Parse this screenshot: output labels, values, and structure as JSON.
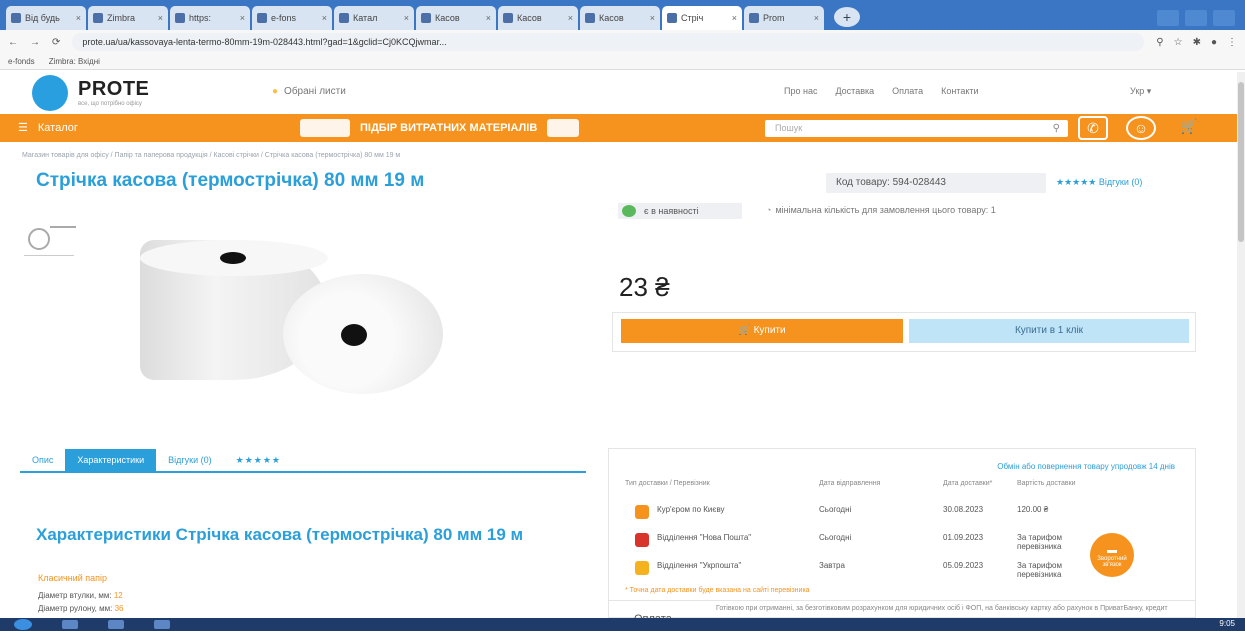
{
  "browser": {
    "tabs": [
      {
        "label": "Від будь"
      },
      {
        "label": "Zimbra"
      },
      {
        "label": "https:"
      },
      {
        "label": "e-fons"
      },
      {
        "label": "Катал"
      },
      {
        "label": "Касов"
      },
      {
        "label": "Касов"
      },
      {
        "label": "Касов"
      },
      {
        "label": "Стріч",
        "active": true
      },
      {
        "label": "Prom"
      }
    ],
    "new_tab": "+",
    "url": "prote.ua/ua/kassovaya-lenta-termo-80mm-19m-028443.html?gad=1&gclid=Cj0KCQjwmar...",
    "bookmarks": [
      "e-fonds",
      "Zimbra: Вхідні"
    ]
  },
  "header": {
    "logo": "PROTE",
    "logo_tagline": "все, що потрібно офісу",
    "favorites": "Обрані листи",
    "nav": [
      "Про нас",
      "Доставка",
      "Оплата",
      "Контакти"
    ],
    "lang": "Укр"
  },
  "orange_bar": {
    "catalog": "Каталог",
    "consumables": "ПІДБІР ВИТРАТНИХ МАТЕРІАЛІВ",
    "search_placeholder": "Пошук",
    "cart_count": "0"
  },
  "breadcrumb": "Магазин товарів для офісу / Папір та паперова продукція / Касові стрічки / Стрічка касова (термострічка) 80 мм 19 м",
  "product": {
    "title": "Стрічка касова (термострічка) 80 мм 19 м",
    "code": "Код товару: 594-028443",
    "rating": "★★★★★ Відгуки (0)",
    "in_stock": "є в наявності",
    "min_qty": "мінімальна кількість для замовлення цього товару: 1",
    "price": "23 ₴",
    "buy": "Купити",
    "one_click": "Купити в 1 клік"
  },
  "tabs": [
    "Опис",
    "Характеристики",
    "Відгуки (0)",
    "★★★★★"
  ],
  "specs": {
    "title": "Характеристики Стрічка касова (термострічка) 80 мм 19 м",
    "section": "Класичний папір",
    "rows": [
      {
        "label": "Діаметр втулки, мм:",
        "value": "12"
      },
      {
        "label": "Діаметр рулону, мм:",
        "value": "36"
      }
    ]
  },
  "delivery": {
    "note": "Обмін або повернення товару упродовж 14 днів",
    "headers": [
      "Тип доставки / Перевізник",
      "Дата відправлення",
      "Дата доставки*",
      "Вартість доставки"
    ],
    "rows": [
      {
        "name": "Кур'єром по Києву",
        "sent": "Сьогодні",
        "date": "30.08.2023",
        "cost": "120.00 ₴",
        "color": "#f5931e"
      },
      {
        "name": "Відділення \"Нова Пошта\"",
        "sent": "Сьогодні",
        "date": "01.09.2023",
        "cost": "За тарифом перевізника",
        "color": "#d9342b"
      },
      {
        "name": "Відділення \"Укрпошта\"",
        "sent": "Завтра",
        "date": "05.09.2023",
        "cost": "За тарифом перевізника",
        "color": "#f5b21e"
      }
    ],
    "footnote": "* Точна дата доставки буде вказана на сайті перевізника"
  },
  "payment": {
    "label": "Оплата",
    "text": "Готівкою при отриманні, за безготівковим розрахунком для юридичних осіб і ФОП, на банківську картку або рахунок в ПриватБанку, кредит"
  },
  "chat": "Зворотний зв'язок",
  "taskbar": {
    "clock": "9:05"
  }
}
